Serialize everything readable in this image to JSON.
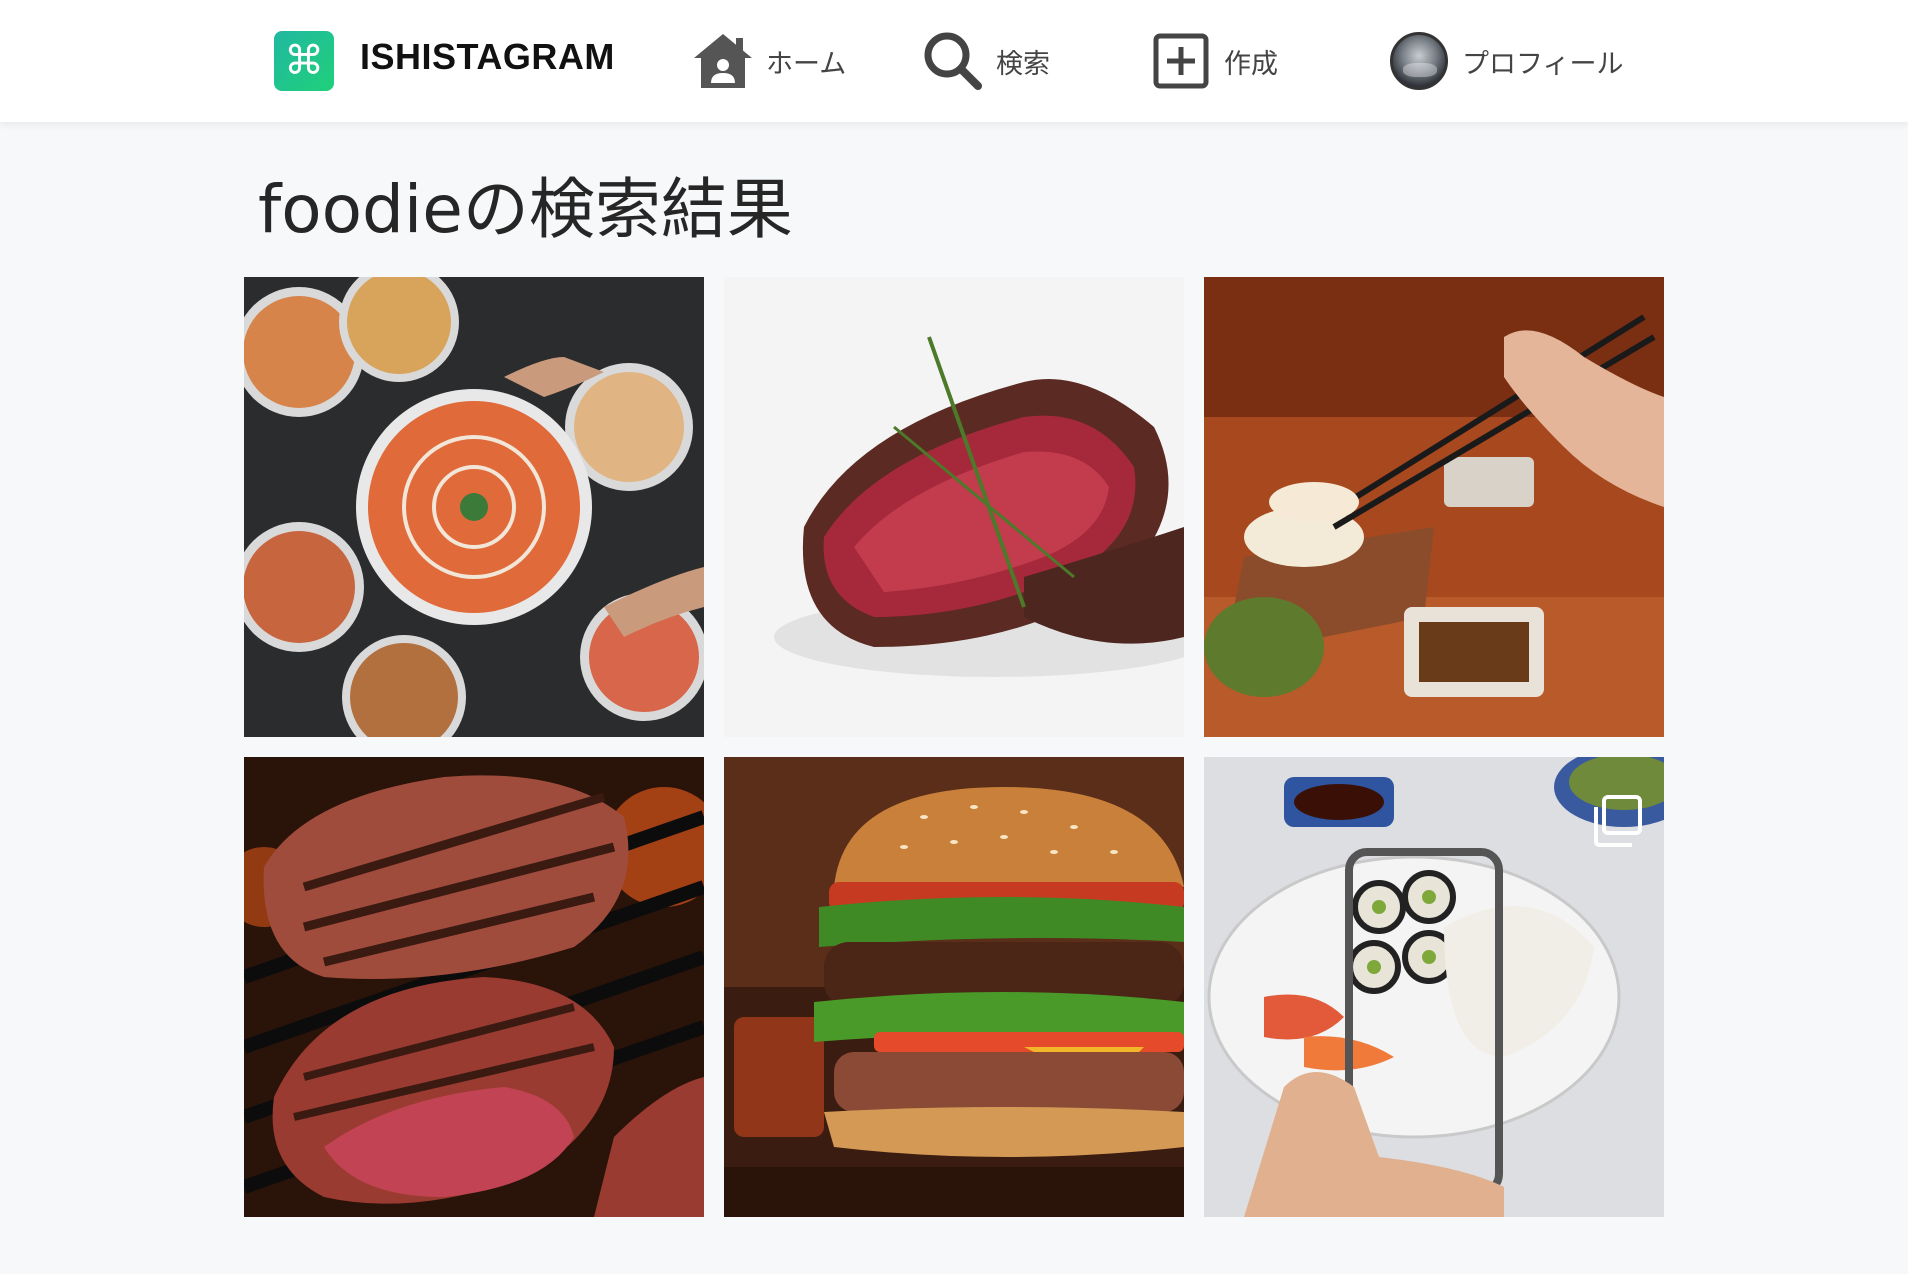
{
  "header": {
    "logo_glyph": "⌘",
    "app_name": "ISHISTAGRAM",
    "nav": [
      {
        "label": "ホーム",
        "icon": "home-icon"
      },
      {
        "label": "検索",
        "icon": "search-icon"
      },
      {
        "label": "作成",
        "icon": "add-square-icon"
      },
      {
        "label": "プロフィール",
        "icon": "avatar"
      }
    ],
    "brand_gradient": [
      "#21b8a0",
      "#1fd07a"
    ]
  },
  "page": {
    "title": "foodieの検索結果"
  },
  "results": [
    {
      "subject": "pizzas",
      "multi_image": false
    },
    {
      "subject": "steak with rosemary",
      "multi_image": false
    },
    {
      "subject": "sushi with chopsticks",
      "multi_image": false
    },
    {
      "subject": "grilled steaks",
      "multi_image": false
    },
    {
      "subject": "burger",
      "multi_image": false
    },
    {
      "subject": "phone photographing sushi",
      "multi_image": true
    }
  ]
}
